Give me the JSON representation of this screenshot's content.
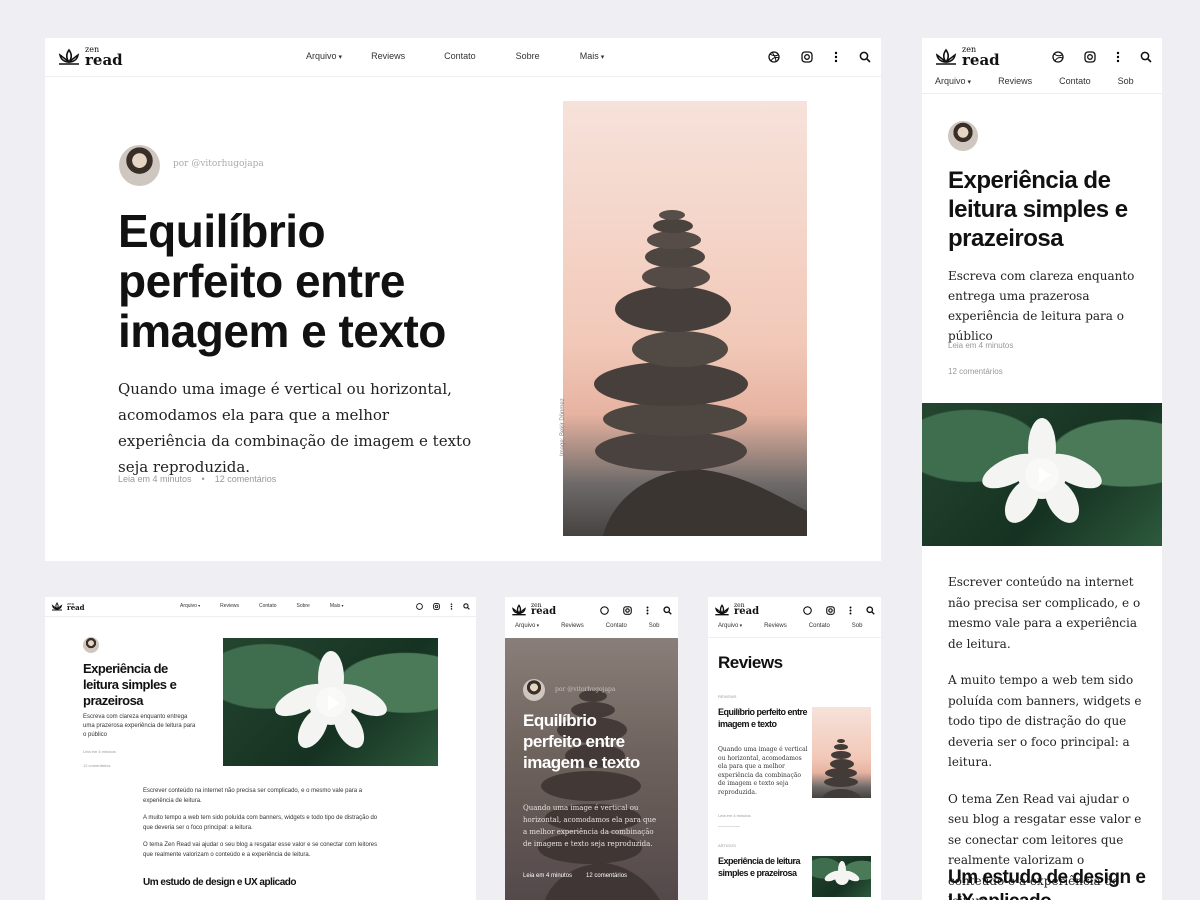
{
  "brand": {
    "top": "zen",
    "bottom": "read"
  },
  "nav": {
    "arquivo": "Arquivo",
    "reviews": "Reviews",
    "contato": "Contato",
    "sobre": "Sobre",
    "sob": "Sob",
    "mais": "Mais"
  },
  "author": "por @vitorhugojapa",
  "hero": {
    "title": "Equilíbrio perfeito entre imagem e texto",
    "excerpt": "Quando uma image é vertical ou horizontal, acomodamos ela para que a melhor experiência da combinação de imagem e texto seja reproduzida.",
    "read_time": "Leia em 4 minutos",
    "separator": "•",
    "comments": "12 comentários",
    "image_credit": "Image: Bekir Dönmez"
  },
  "post2": {
    "title": "Experiência de leitura simples e prazeirosa",
    "excerpt": "Escreva com clareza enquanto entrega uma prazerosa experiência de leitura para o público",
    "read_time": "Leia em 4 minutos",
    "comments": "12 comentários",
    "p1": "Escrever conteúdo na internet não precisa ser complicado, e o mesmo vale para a experiência de leitura.",
    "p2": "A muito tempo a web tem sido poluída com banners, widgets e todo tipo de distração do que deveria ser o foco principal: a leitura.",
    "p3": "O tema Zen Read vai ajudar o seu blog a resgatar esse valor e se conectar com leitores que realmente valorizam o conteúdo e a experiência de leitura.",
    "h2": "Um estudo de design e UX aplicado"
  },
  "reviews_page": {
    "heading": "Reviews",
    "tag1": "REVIEWS",
    "item1_title": "Equilíbrio perfeito entre imagem e texto",
    "item1_excerpt": "Quando uma image é vertical ou horizontal, acomodamos ela para que a melhor experiência da combinação de imagem e texto seja reproduzida.",
    "item1_meta": "Leia em 4 minutos",
    "tag2": "ARTIGOS",
    "item2_title": "Experiência de leitura simples e prazeirosa"
  }
}
